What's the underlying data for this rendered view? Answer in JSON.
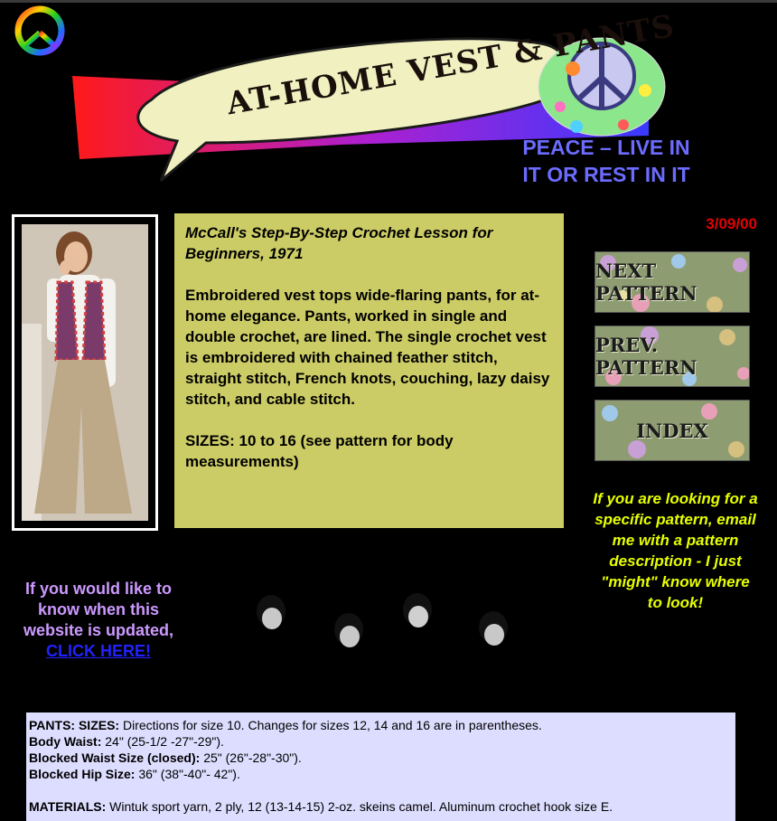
{
  "header": {
    "banner_title": "AT-HOME VEST & PANTS",
    "slogan_line1": "PEACE – LIVE IN",
    "slogan_line2": "IT OR REST IN IT"
  },
  "date": "3/09/00",
  "description": {
    "book": "McCall's Step-By-Step Crochet Lesson for Beginners, 1971",
    "body": "Embroidered vest tops wide-flaring pants, for at-home elegance. Pants, worked in single and double crochet, are lined. The single crochet vest is embroidered with chained feather stitch, straight stitch, French knots, couching, lazy daisy stitch, and cable stitch.",
    "sizes": "SIZES:  10 to 16 (see pattern for body measurements)"
  },
  "nav": {
    "next": "NEXT PATTERN",
    "prev": "PREV. PATTERN",
    "index": "INDEX"
  },
  "looking_text": "If you are looking for a specific pattern, email me with a pattern description - I just \"might\" know where to look!",
  "update": {
    "text": "If you would like to know when this website is updated,",
    "link": "CLICK HERE!"
  },
  "materials": {
    "pants_label": "PANTS: SIZES:",
    "pants_text": " Directions for size 10. Changes for sizes 12, 14 and 16 are in parentheses.",
    "body_waist_label": "Body Waist:",
    "body_waist_text": " 24\" (25-1/2 -27\"-29\").",
    "blocked_waist_label": "Blocked Waist Size (closed):",
    "blocked_waist_text": " 25\" (26\"-28\"-30\").",
    "blocked_hip_label": "Blocked Hip Size:",
    "blocked_hip_text": " 36\" (38\"-40\"- 42\").",
    "materials_label": "MATERIALS:",
    "materials_text": " Wintuk sport yarn, 2 ply, 12 (13-14-15) 2-oz. skeins camel. Aluminum crochet hook size E."
  },
  "colors": {
    "background": "#000000",
    "desc_box": "#cccc66",
    "slogan": "#6b6bff",
    "date": "#e80000",
    "looking": "#e6ff00",
    "update": "#cc99ff",
    "link": "#2222ff",
    "materials_box": "#ddddff"
  }
}
